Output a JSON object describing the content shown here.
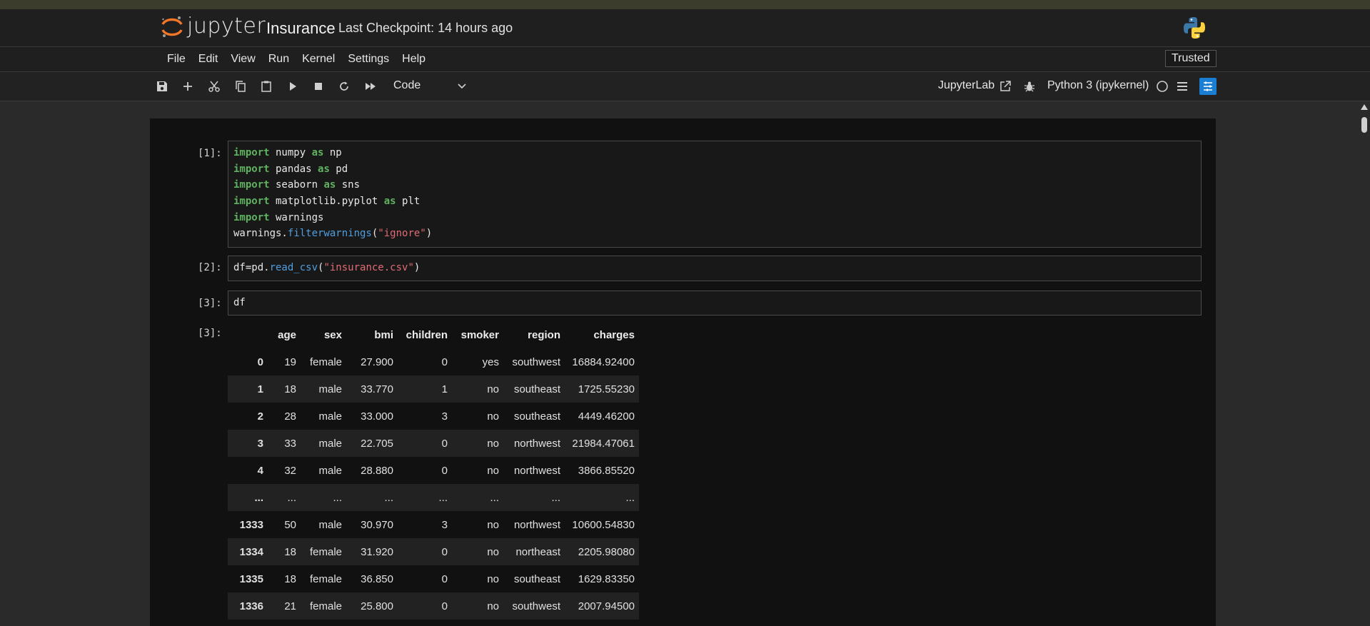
{
  "header": {
    "logo_text": "jupyter",
    "notebook_title": "Insurance",
    "checkpoint": "Last Checkpoint: 14 hours ago"
  },
  "menu": {
    "items": [
      "File",
      "Edit",
      "View",
      "Run",
      "Kernel",
      "Settings",
      "Help"
    ],
    "trusted": "Trusted"
  },
  "toolbar": {
    "cell_type": "Code",
    "jupyterlab": "JupyterLab",
    "kernel": "Python 3 (ipykernel)"
  },
  "cells": [
    {
      "prompt": "[1]:",
      "lines": [
        "import numpy as np",
        "import pandas as pd",
        "import seaborn as sns",
        "import matplotlib.pyplot as plt",
        "import warnings",
        "warnings.filterwarnings(\"ignore\")"
      ]
    },
    {
      "prompt": "[2]:",
      "lines": [
        "df=pd.read_csv(\"insurance.csv\")"
      ]
    },
    {
      "prompt": "[3]:",
      "lines": [
        "df"
      ]
    }
  ],
  "output": {
    "prompt": "[3]:",
    "columns": [
      "",
      "age",
      "sex",
      "bmi",
      "children",
      "smoker",
      "region",
      "charges"
    ],
    "rows": [
      [
        "0",
        "19",
        "female",
        "27.900",
        "0",
        "yes",
        "southwest",
        "16884.92400"
      ],
      [
        "1",
        "18",
        "male",
        "33.770",
        "1",
        "no",
        "southeast",
        "1725.55230"
      ],
      [
        "2",
        "28",
        "male",
        "33.000",
        "3",
        "no",
        "southeast",
        "4449.46200"
      ],
      [
        "3",
        "33",
        "male",
        "22.705",
        "0",
        "no",
        "northwest",
        "21984.47061"
      ],
      [
        "4",
        "32",
        "male",
        "28.880",
        "0",
        "no",
        "northwest",
        "3866.85520"
      ],
      [
        "...",
        "...",
        "...",
        "...",
        "...",
        "...",
        "...",
        "..."
      ],
      [
        "1333",
        "50",
        "male",
        "30.970",
        "3",
        "no",
        "northwest",
        "10600.54830"
      ],
      [
        "1334",
        "18",
        "female",
        "31.920",
        "0",
        "no",
        "northeast",
        "2205.98080"
      ],
      [
        "1335",
        "18",
        "female",
        "36.850",
        "0",
        "no",
        "southeast",
        "1629.83350"
      ],
      [
        "1336",
        "21",
        "female",
        "25.800",
        "0",
        "no",
        "southwest",
        "2007.94500"
      ]
    ]
  },
  "colors": {
    "keyword": "#5fb25f",
    "function": "#4f9fe0",
    "string": "#e06b74",
    "accent": "#1a7fd4"
  }
}
